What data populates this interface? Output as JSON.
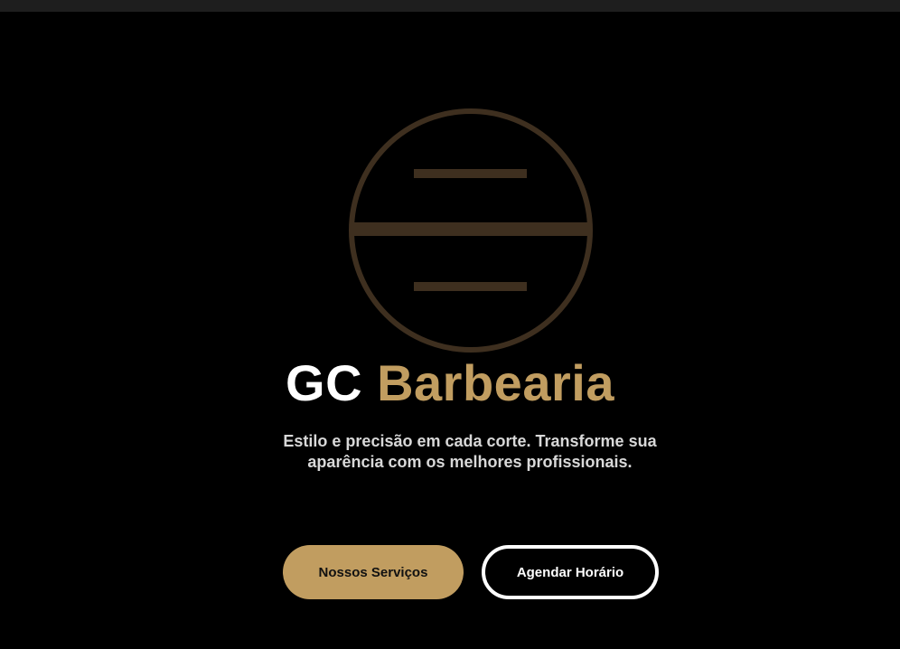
{
  "brand": {
    "name_part1": "GC",
    "name_part2": "Barbearia",
    "logo_icon": "barber-pole-circle-icon"
  },
  "hero": {
    "tagline": "Estilo e precisão em cada corte. Transforme sua aparência com os melhores profissionais."
  },
  "actions": {
    "services_label": "Nossos Serviços",
    "schedule_label": "Agendar Horário"
  },
  "colors": {
    "background": "#000000",
    "accent_gold": "#c19d60",
    "logo_brown": "#3e2f1f",
    "text_light": "#d8d8d8"
  }
}
